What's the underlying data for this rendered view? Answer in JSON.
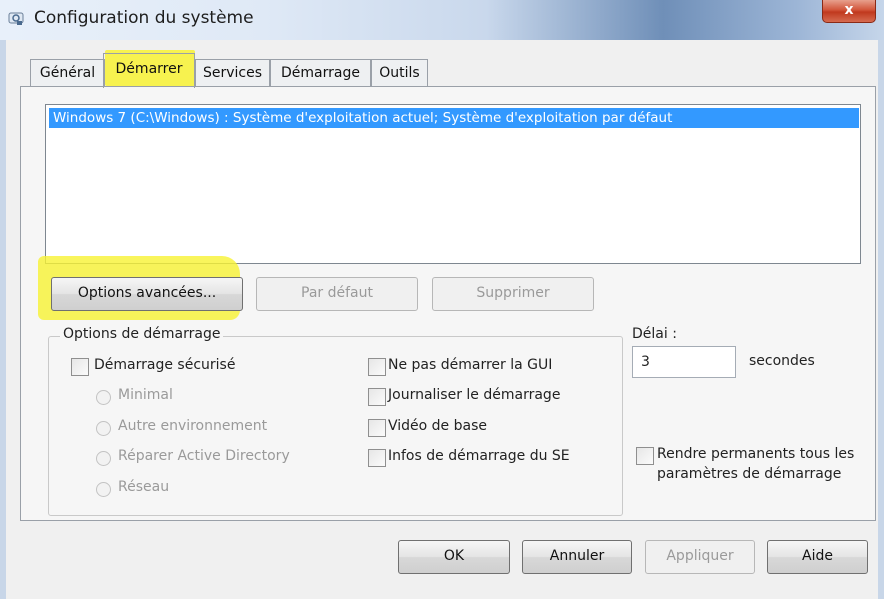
{
  "window": {
    "title": "Configuration du système",
    "close_glyph": "x"
  },
  "tabs": [
    {
      "label": "Général"
    },
    {
      "label": "Démarrer",
      "active": true
    },
    {
      "label": "Services"
    },
    {
      "label": "Démarrage"
    },
    {
      "label": "Outils"
    }
  ],
  "os_list": {
    "items": [
      "Windows 7 (C:\\Windows) : Système d'exploitation actuel; Système d'exploitation par défaut"
    ]
  },
  "os_buttons": {
    "advanced": "Options avancées...",
    "default": "Par défaut",
    "delete": "Supprimer"
  },
  "boot_options": {
    "title": "Options de démarrage",
    "safe_boot": {
      "label": "Démarrage sécurisé",
      "checked": false
    },
    "radios": [
      "Minimal",
      "Autre environnement",
      "Réparer Active Directory",
      "Réseau"
    ],
    "checkboxes": [
      {
        "label": "Ne pas démarrer la GUI",
        "checked": false
      },
      {
        "label": "Journaliser le démarrage",
        "checked": false
      },
      {
        "label": "Vidéo de base",
        "checked": false
      },
      {
        "label": "Infos de démarrage du SE",
        "checked": false
      }
    ]
  },
  "timeout": {
    "label": "Délai :",
    "value": "3",
    "unit": "secondes"
  },
  "persist": {
    "label": "Rendre permanents tous les paramètres de démarrage",
    "checked": false
  },
  "dialog_buttons": {
    "ok": "OK",
    "cancel": "Annuler",
    "apply": "Appliquer",
    "help": "Aide"
  },
  "highlight_color": "#f8f233",
  "selection_color": "#3399ff"
}
